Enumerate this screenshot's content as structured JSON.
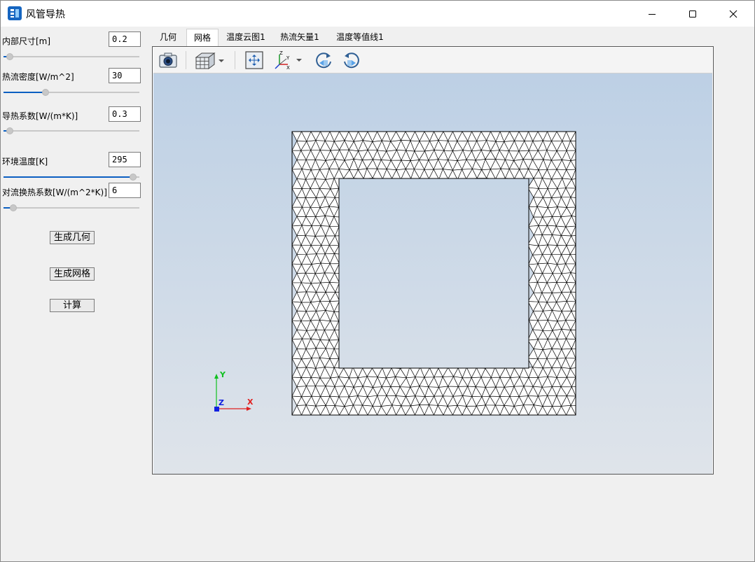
{
  "window": {
    "title": "风管导热"
  },
  "params": [
    {
      "label": "内部尺寸[m]",
      "value": "0.2",
      "slider": 0.02
    },
    {
      "label": "热流密度[W/m^2]",
      "value": "30",
      "slider": 0.3
    },
    {
      "label": "导热系数[W/(m*K)]",
      "value": "0.3",
      "slider": 0.02
    },
    {
      "label": "环境温度[K]",
      "value": "295",
      "slider": 0.98
    },
    {
      "label": "对流换热系数[W/(m^2*K)]",
      "value": "6",
      "slider": 0.05
    }
  ],
  "buttons": {
    "generate_geometry": "生成几何",
    "generate_mesh": "生成网格",
    "compute": "计算"
  },
  "tabs": [
    {
      "label": "几何",
      "active": false
    },
    {
      "label": "网格",
      "active": true
    },
    {
      "label": "温度云图1",
      "active": false
    },
    {
      "label": "热流矢量1",
      "active": false
    },
    {
      "label": "温度等值线1",
      "active": false
    }
  ],
  "axes": {
    "x": "X",
    "y": "Y",
    "z": "Z",
    "x_color": "#e02020",
    "y_color": "#10c020",
    "z_color": "#1020e0"
  },
  "toolbar": {
    "icons": [
      "camera-icon",
      "cube-view-icon",
      "fit-view-icon",
      "axis-orientation-icon",
      "rotate-left-icon",
      "rotate-right-icon"
    ]
  }
}
